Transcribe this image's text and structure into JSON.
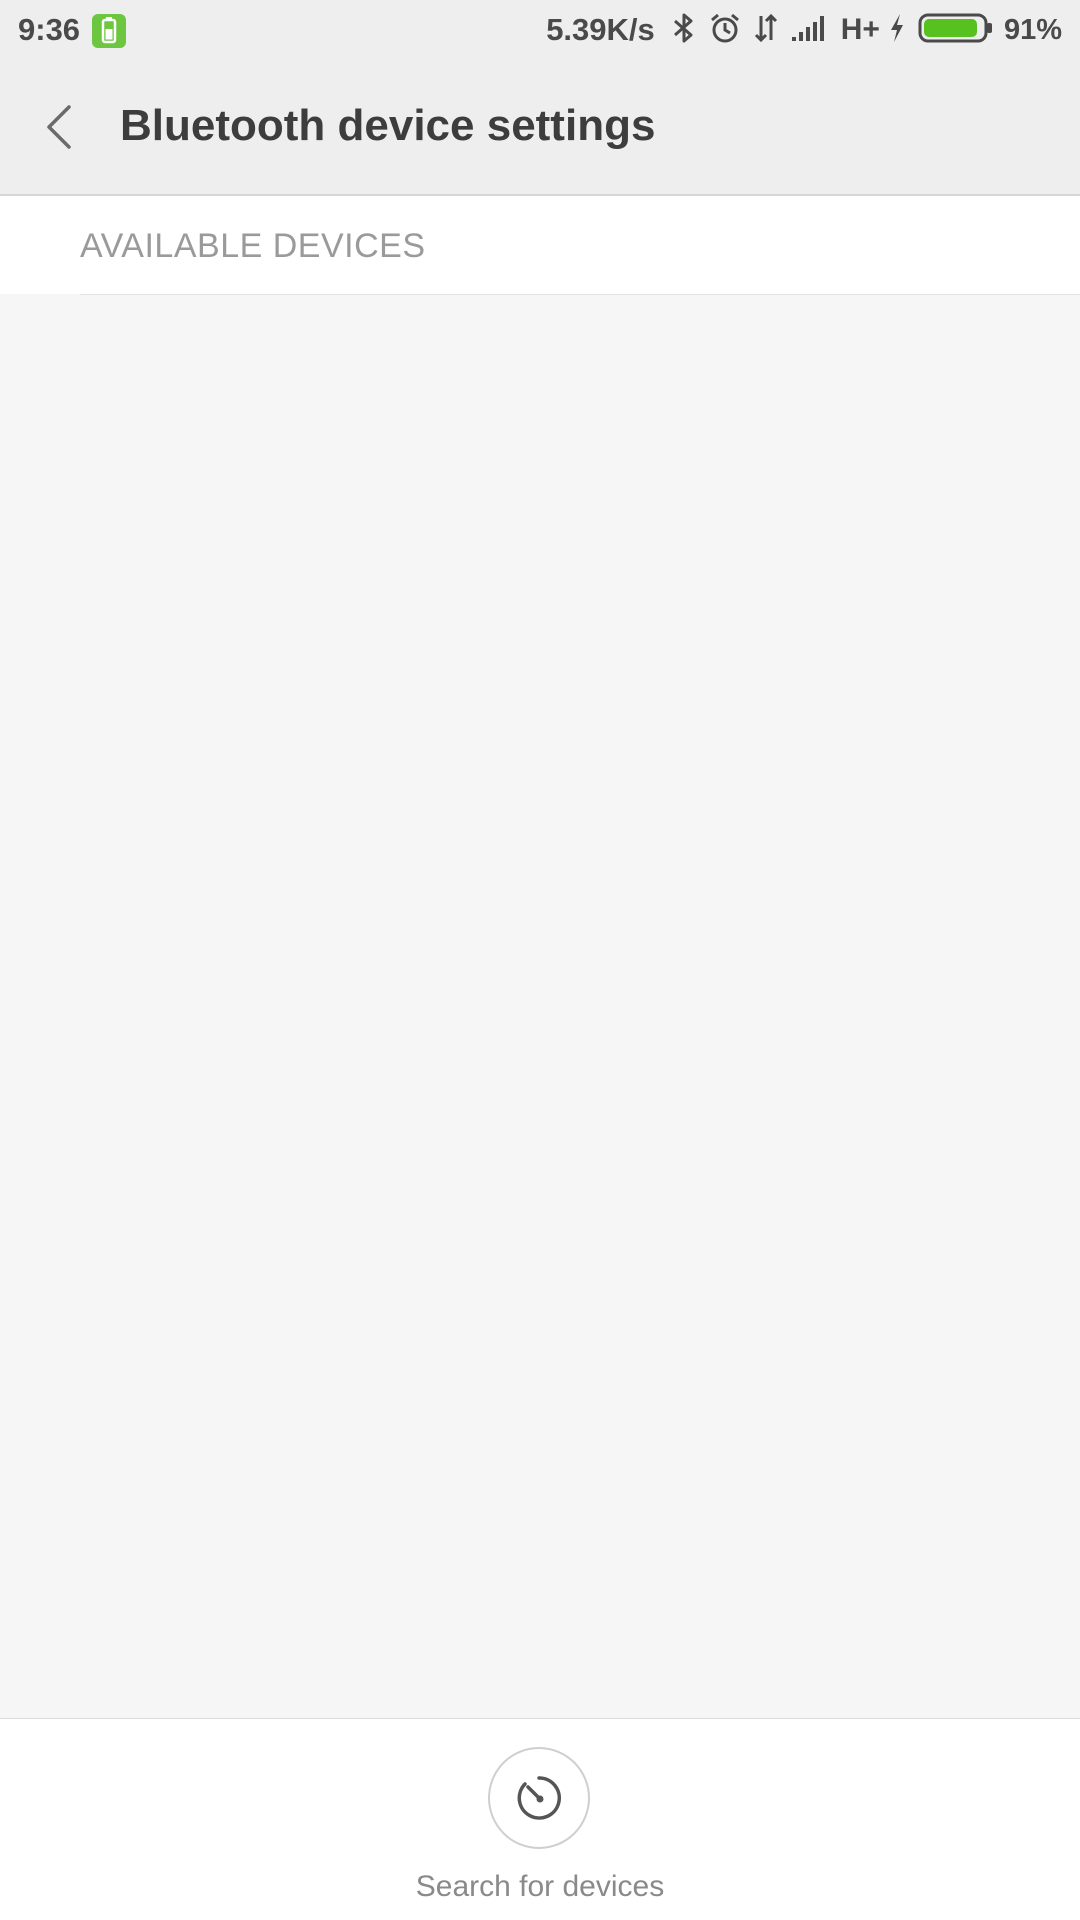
{
  "status_bar": {
    "time": "9:36",
    "network_speed": "5.39K/s",
    "network_type": "H+",
    "battery_percent": "91%",
    "battery_level": 0.91,
    "icons": [
      "battery-app-icon",
      "bluetooth-icon",
      "alarm-icon",
      "data-arrows-icon",
      "signal-icon",
      "charging-icon",
      "battery-icon"
    ],
    "battery_color": "#6cc63f"
  },
  "toolbar": {
    "title": "Bluetooth device settings",
    "back_icon": "chevron-left-icon"
  },
  "section": {
    "title": "AVAILABLE DEVICES"
  },
  "bottom_bar": {
    "search_label": "Search for devices",
    "search_icon": "radar-scan-icon"
  },
  "colors": {
    "background": "#f6f6f6",
    "toolbar": "#eeeeee",
    "title_text": "#3d3d3d",
    "section_text": "#9a9a9a",
    "accent_battery": "#6cc63f"
  }
}
